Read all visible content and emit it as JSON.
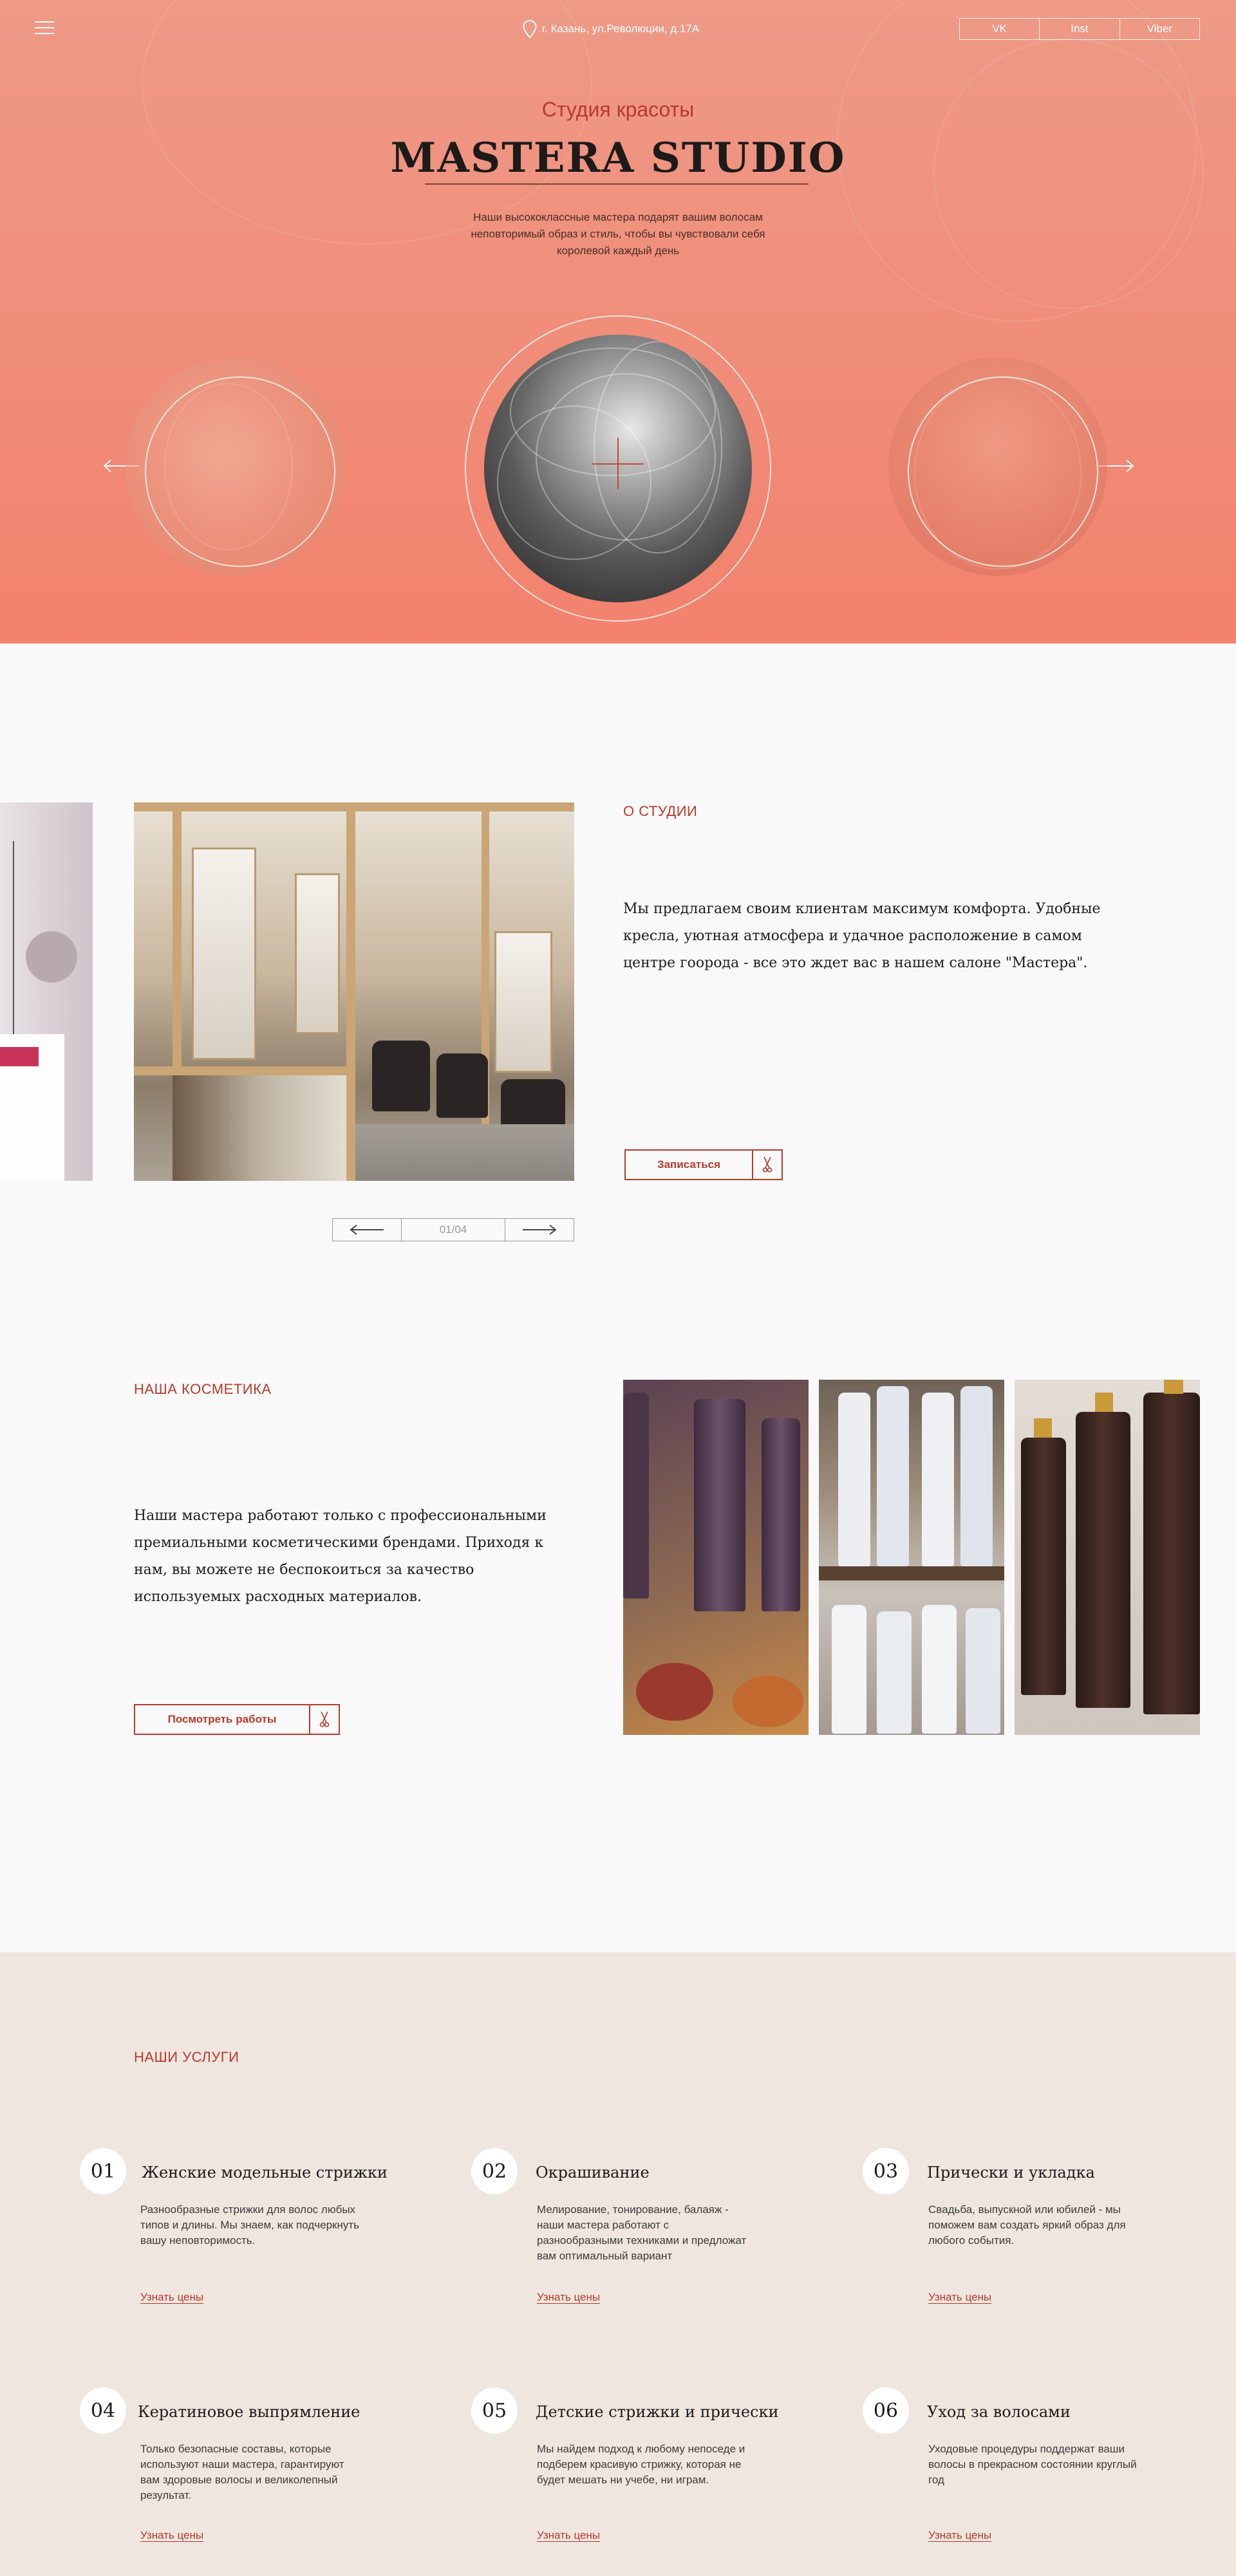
{
  "header": {
    "address": "г. Казань, ул.Революции, д.17А",
    "socials": [
      "VK",
      "Inst",
      "Viber"
    ]
  },
  "hero": {
    "subtitle": "Студия красоты",
    "title": "MASTERA STUDIO",
    "description": "Наши высококлассные мастера подарят вашим волосам неповторимый образ и стиль, чтобы вы чувствовали себя королевой каждый день"
  },
  "about": {
    "label": "О СТУДИИ",
    "text": "Мы предлагаем своим клиентам максимум комфорта. Удобные кресла, уютная атмосфера и удачное расположение в самом центре гоорода - все это ждет вас в нашем салоне \"Мастера\".",
    "button": "Записаться",
    "pager": "01/04"
  },
  "cosmetics": {
    "label": "НАША КОСМЕТИКА",
    "text": "Наши мастера работают только с профессиональными премиальными косметическими брендами. Приходя к нам, вы можете не беспокоиться за качество используемых расходных материалов.",
    "button": "Посмотреть работы"
  },
  "services": {
    "label": "НАШИ УСЛУГИ",
    "link": "Узнать цены",
    "items": [
      {
        "num": "01",
        "title": "Женские модельные стрижки",
        "desc": "Разнообразные стрижки для волос любых типов и длины. Мы знаем, как подчеркнуть вашу неповторимость."
      },
      {
        "num": "02",
        "title": "Окрашивание",
        "desc": "Мелирование, тонирование, балаяж - наши мастера работают с разнообразными техниками и предложат вам оптимальный вариант"
      },
      {
        "num": "03",
        "title": "Прически и укладка",
        "desc": "Свадьба, выпускной или юбилей - мы поможем вам создать яркий образ для любого события."
      },
      {
        "num": "04",
        "title": "Кератиновое выпрямление",
        "desc": "Только безопасные составы, которые используют наши мастера, гарантируют вам здоровые волосы и великолепный результат."
      },
      {
        "num": "05",
        "title": "Детские стрижки и прически",
        "desc": "Мы найдем подход к любому непоседе и подберем красивую стрижку, которая не будет мешать ни учебе, ни играм."
      },
      {
        "num": "06",
        "title": "Уход за волосами",
        "desc": "Уходовые процедуры поддержат ваши волосы в прекрасном состоянии круглый год"
      }
    ]
  },
  "colors": {
    "accent": "#b83a2a",
    "hero": "#f08d79",
    "services_bg": "#efe6e0"
  },
  "icons": [
    "menu-icon",
    "location-pin-icon",
    "arrow-left-icon",
    "arrow-right-icon",
    "scissors-icon"
  ]
}
